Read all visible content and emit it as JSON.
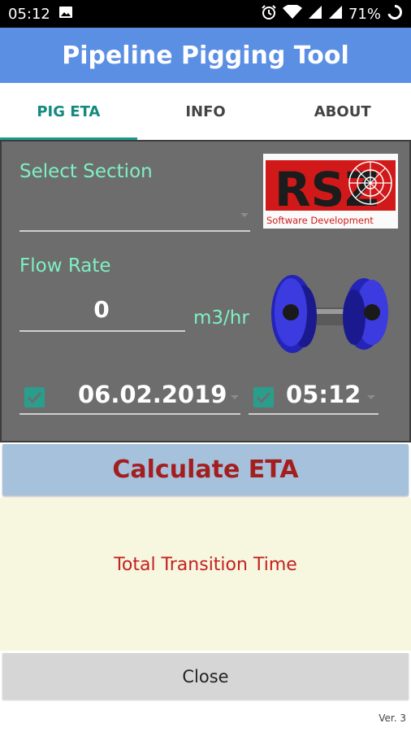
{
  "status_bar": {
    "time": "05:12",
    "battery": "71%",
    "icons": [
      "image-icon",
      "alarm-icon",
      "wifi-icon",
      "signal-icon",
      "battery-icon"
    ]
  },
  "app_bar": {
    "title": "Pipeline Pigging Tool"
  },
  "tabs": [
    {
      "label": "PIG ETA",
      "active": true
    },
    {
      "label": "INFO",
      "active": false
    },
    {
      "label": "ABOUT",
      "active": false
    }
  ],
  "form": {
    "select_section_label": "Select Section",
    "select_section_value": "",
    "flow_rate_label": "Flow Rate",
    "flow_rate_value": "0",
    "flow_rate_unit": "m3/hr",
    "date_checked": true,
    "date_value": "06.02.2019",
    "time_checked": true,
    "time_value": "05:12"
  },
  "logo": {
    "caption": "Software Development",
    "letters": "RSZ"
  },
  "buttons": {
    "calculate": "Calculate ETA",
    "close": "Close"
  },
  "result": {
    "label": "Total Transition Time"
  },
  "version": "Ver. 3",
  "colors": {
    "accent": "#5b8fe4",
    "tab_active": "#138a7e",
    "label_green": "#7ff0c4",
    "calc_text": "#a31f1f"
  }
}
